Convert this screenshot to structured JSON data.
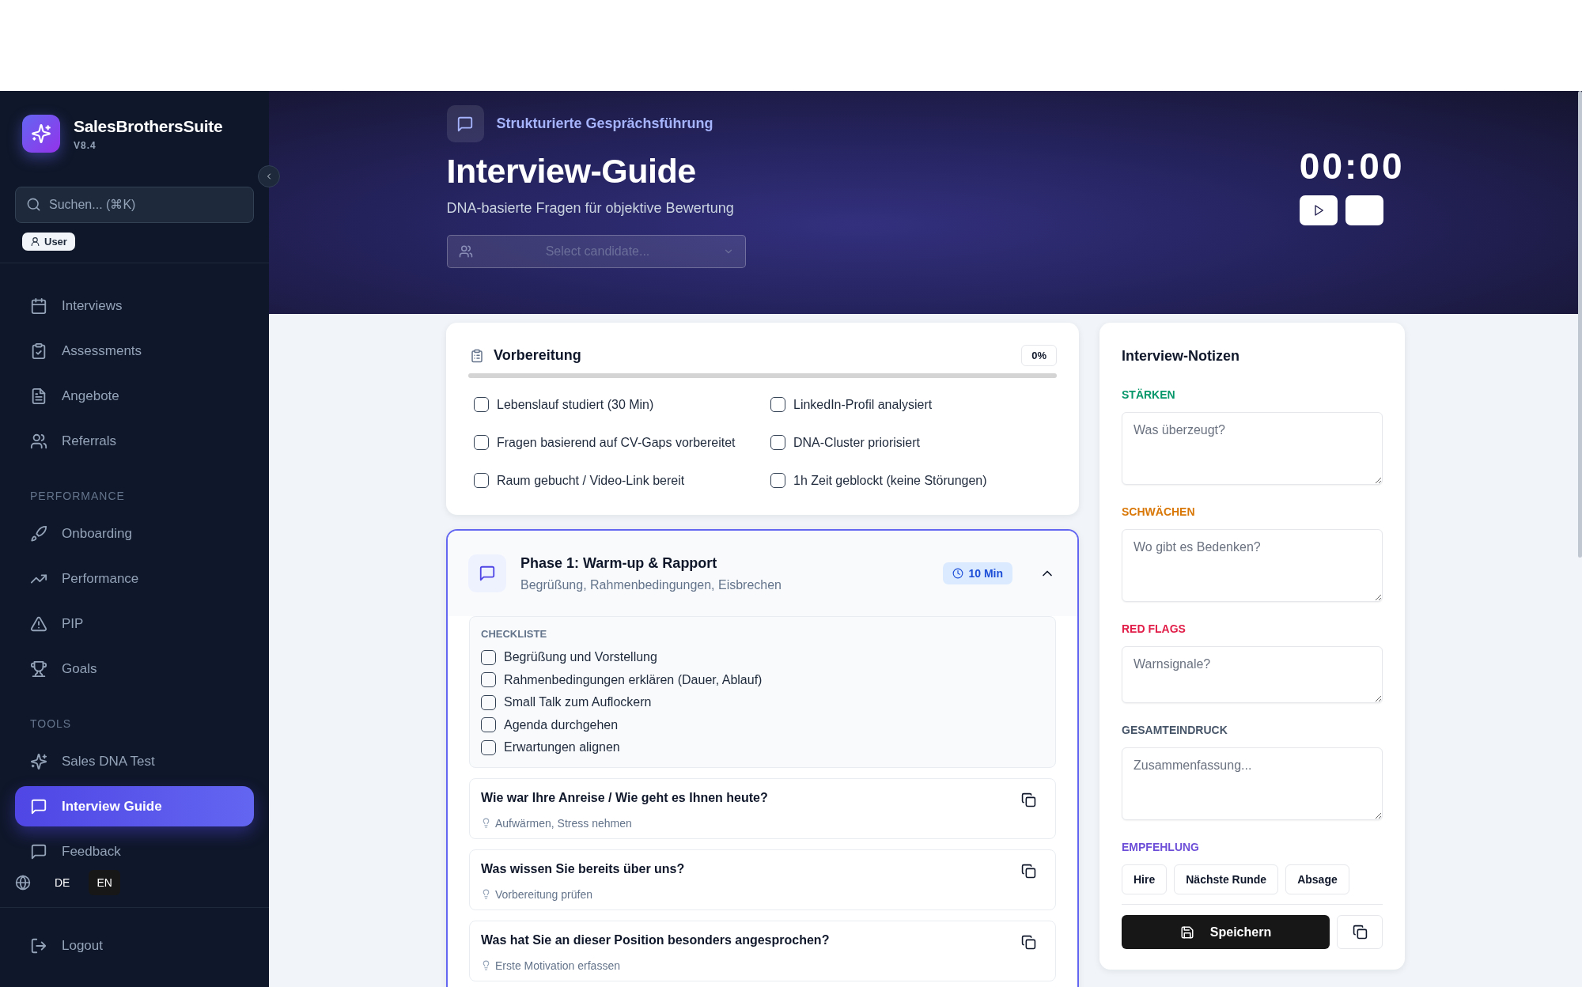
{
  "sidebar": {
    "brand": "SalesBrothersSuite",
    "version": "V8.4",
    "search": {
      "placeholder": "Suchen... (⌘K)"
    },
    "role": "User",
    "sections": [
      {
        "items": [
          {
            "label": "Interviews",
            "selected": false
          },
          {
            "label": "Assessments",
            "selected": false
          },
          {
            "label": "Angebote",
            "selected": false
          },
          {
            "label": "Referrals",
            "selected": false
          }
        ]
      },
      {
        "label": "PERFORMANCE",
        "items": [
          {
            "label": "Onboarding",
            "selected": false
          },
          {
            "label": "Performance",
            "selected": false
          },
          {
            "label": "PIP",
            "selected": false
          },
          {
            "label": "Goals",
            "selected": false
          }
        ]
      },
      {
        "label": "TOOLS",
        "items": [
          {
            "label": "Sales DNA Test",
            "selected": false
          },
          {
            "label": "Interview Guide",
            "selected": true
          },
          {
            "label": "Feedback",
            "selected": false
          }
        ]
      }
    ],
    "languages": [
      {
        "label": "DE",
        "selected": false
      },
      {
        "label": "EN",
        "selected": true
      }
    ],
    "logout": "Logout"
  },
  "header": {
    "eyebrow": "Strukturierte Gesprächsführung",
    "title": "Interview-Guide",
    "subtitle": "DNA-basierte Fragen für objektive Bewertung",
    "candidate_select": {
      "placeholder": "Select candidate..."
    },
    "timer": "00:00"
  },
  "preparation": {
    "title": "Vorbereitung",
    "percent": "0%",
    "level": 0,
    "items": [
      {
        "label": "Lebenslauf studiert (30 Min)",
        "checked": false
      },
      {
        "label": "LinkedIn-Profil analysiert",
        "checked": false
      },
      {
        "label": "Fragen basierend auf CV-Gaps vorbereitet",
        "checked": false
      },
      {
        "label": "DNA-Cluster priorisiert",
        "checked": false
      },
      {
        "label": "Raum gebucht / Video-Link bereit",
        "checked": false
      },
      {
        "label": "1h Zeit geblockt (keine Störungen)",
        "checked": false
      }
    ]
  },
  "phase": {
    "title": "Phase 1: Warm-up & Rapport",
    "subtitle": "Begrüßung, Rahmenbedingungen, Eisbrechen",
    "duration": "10 Min",
    "expanded": true,
    "checklist_title": "CHECKLISTE",
    "checklist": [
      {
        "label": "Begrüßung und Vorstellung",
        "checked": false
      },
      {
        "label": "Rahmenbedingungen erklären (Dauer, Ablauf)",
        "checked": false
      },
      {
        "label": "Small Talk zum Auflockern",
        "checked": false
      },
      {
        "label": "Agenda durchgehen",
        "checked": false
      },
      {
        "label": "Erwartungen alignen",
        "checked": false
      }
    ],
    "questions": [
      {
        "text": "Wie war Ihre Anreise / Wie geht es Ihnen heute?",
        "hint": "Aufwärmen, Stress nehmen"
      },
      {
        "text": "Was wissen Sie bereits über uns?",
        "hint": "Vorbereitung prüfen"
      },
      {
        "text": "Was hat Sie an dieser Position besonders angesprochen?",
        "hint": "Erste Motivation erfassen"
      }
    ]
  },
  "notes": {
    "title": "Interview-Notizen",
    "fields": [
      {
        "label": "STÄRKEN",
        "color": "#059669",
        "placeholder": "Was überzeugt?"
      },
      {
        "label": "SCHWÄCHEN",
        "color": "#d97706",
        "placeholder": "Wo gibt es Bedenken?"
      },
      {
        "label": "RED FLAGS",
        "color": "#e11d48",
        "placeholder": "Warnsignale?"
      },
      {
        "label": "GESAMTEINDRUCK",
        "color": "#475569",
        "placeholder": "Zusammenfassung..."
      }
    ],
    "recommendation": {
      "label": "EMPFEHLUNG",
      "color": "#6d4fd8",
      "options": [
        {
          "label": "Hire",
          "selected": false
        },
        {
          "label": "Nächste Runde",
          "selected": false
        },
        {
          "label": "Absage",
          "selected": false
        }
      ]
    },
    "save": "Speichern"
  }
}
